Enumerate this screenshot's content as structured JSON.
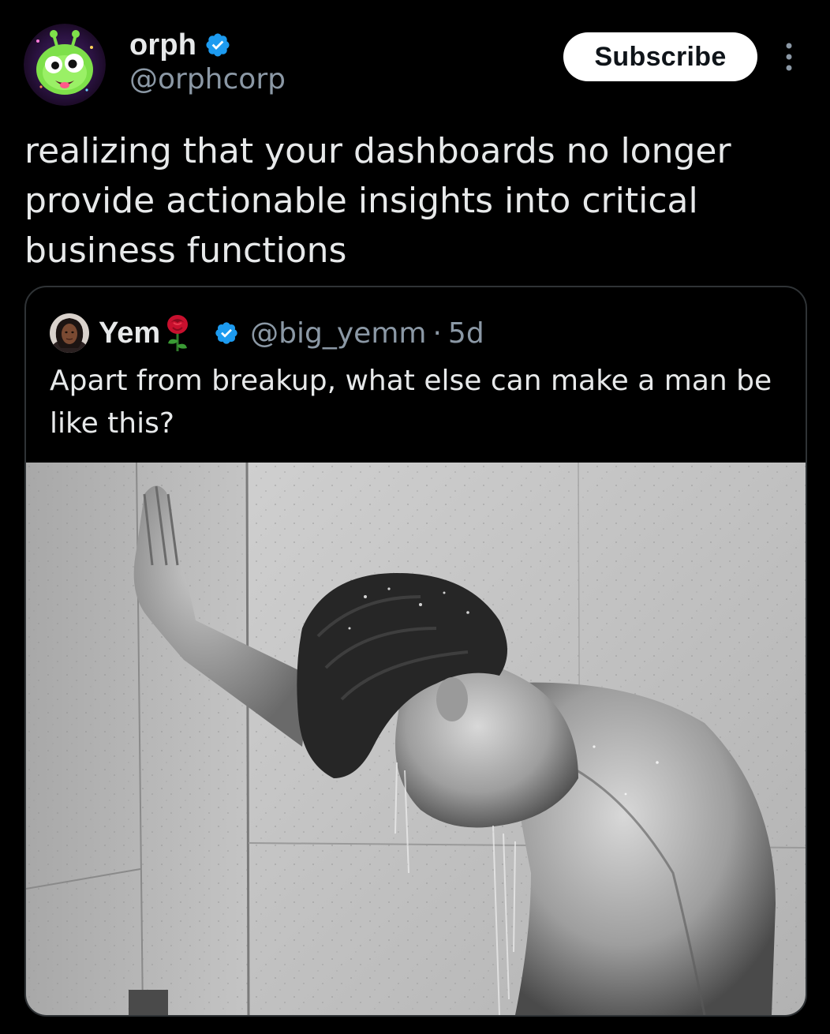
{
  "author": {
    "display_name": "orph",
    "handle": "@orphcorp",
    "avatar": "alien-mascot-avatar"
  },
  "actions": {
    "subscribe_label": "Subscribe",
    "more_icon": "more-vertical-icon"
  },
  "tweet": {
    "text": "realizing that your dashboards no longer provide actionable insights into critical business functions"
  },
  "quoted_tweet": {
    "display_name": "Yem",
    "name_emoji": "rose-icon",
    "handle": "@big_yemm",
    "separator": "·",
    "time": "5d",
    "text": "Apart from breakup, what else can make a man be like this?",
    "media": "shower-photo"
  },
  "colors": {
    "background": "#000000",
    "text_primary": "#e7e9ea",
    "text_secondary": "#8b98a5",
    "verified_blue": "#1d9bf0",
    "card_border": "#2f3336"
  }
}
